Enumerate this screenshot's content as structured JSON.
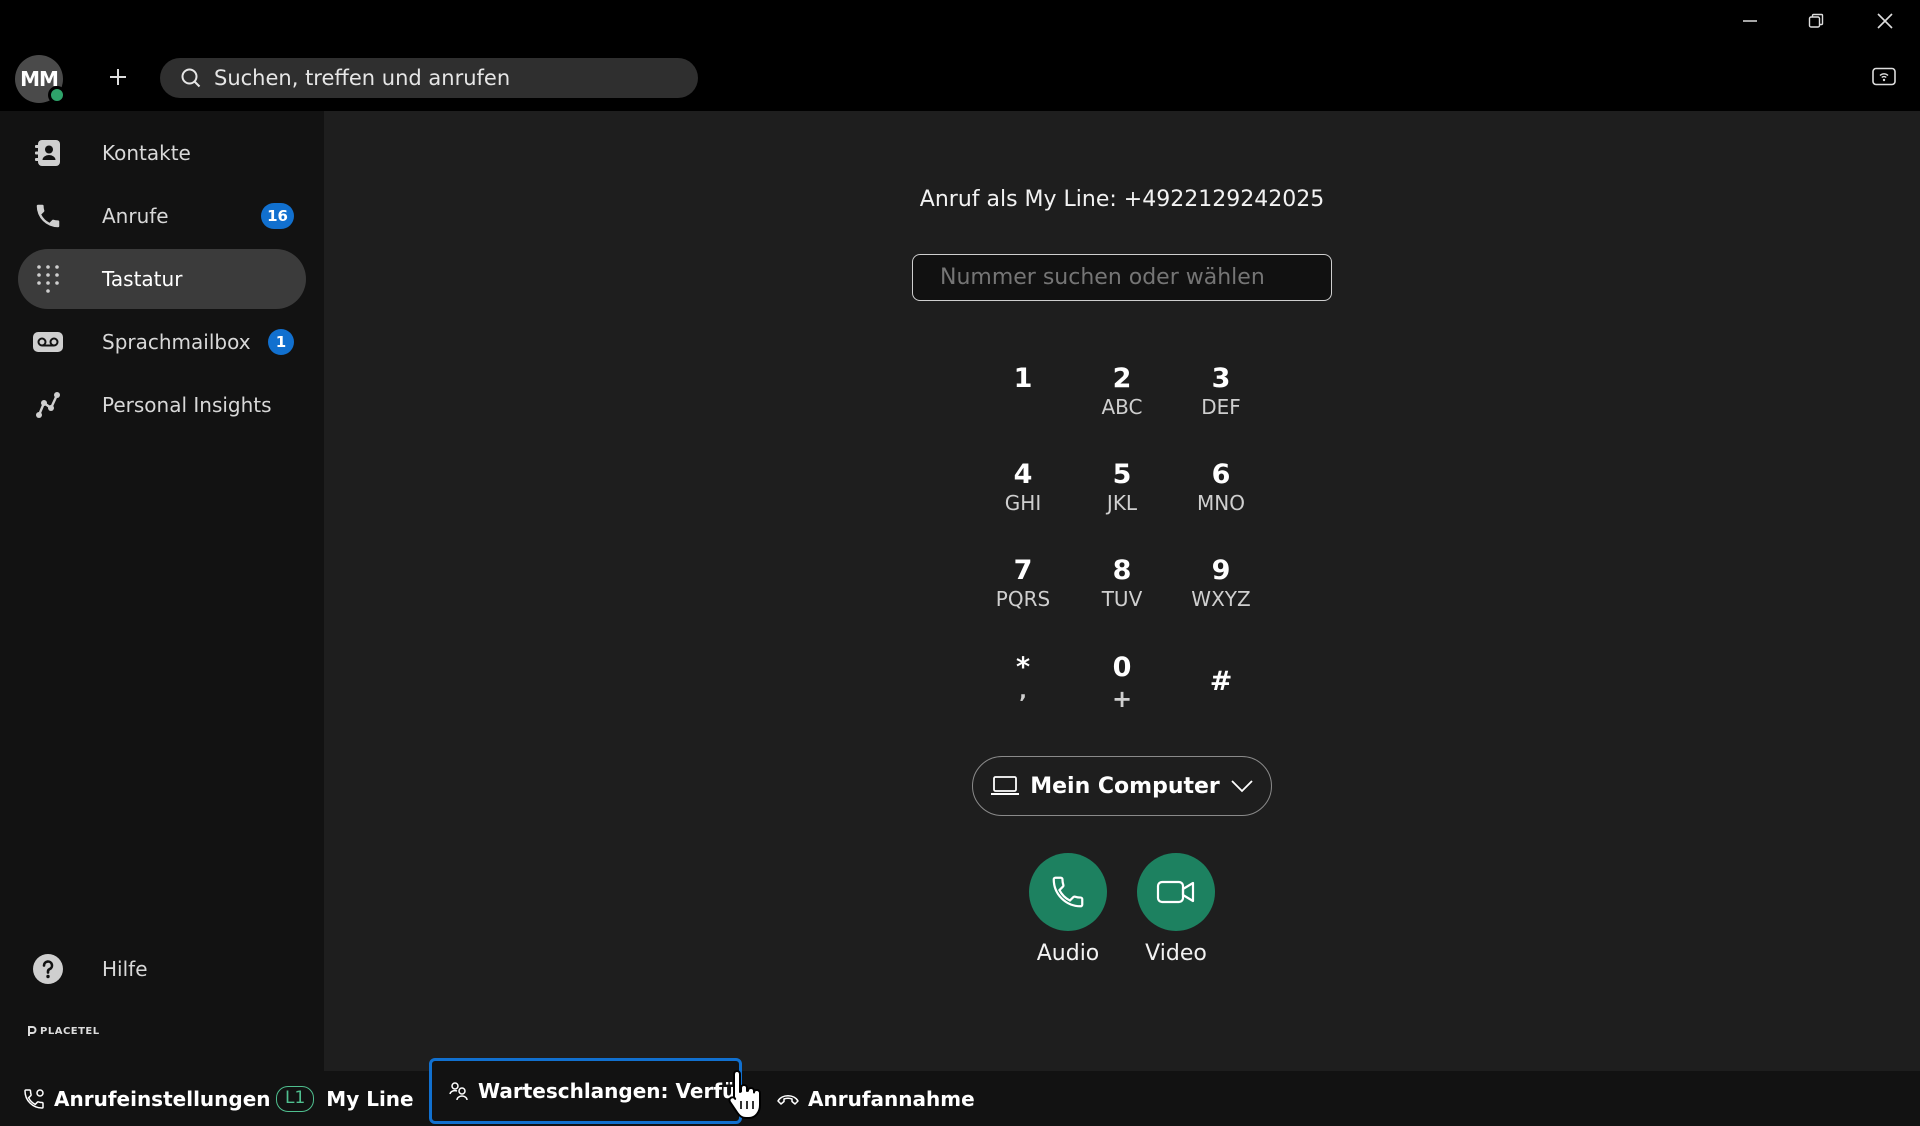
{
  "window": {
    "avatar_initials": "MM",
    "presence_color": "#2ea36a",
    "search_placeholder": "Suchen, treffen und anrufen"
  },
  "sidebar": {
    "items": [
      {
        "label": "Kontakte",
        "icon": "contacts-icon"
      },
      {
        "label": "Anrufe",
        "icon": "phone-icon",
        "badge": "16"
      },
      {
        "label": "Tastatur",
        "icon": "dialpad-icon",
        "active": true
      },
      {
        "label": "Sprachmailbox",
        "icon": "voicemail-icon",
        "badge": "1"
      },
      {
        "label": "Personal Insights",
        "icon": "insights-icon"
      }
    ],
    "help_label": "Hilfe",
    "brand": "PLACETEL"
  },
  "dialer": {
    "call_as": "Anruf als My Line: +4922129242025",
    "input_placeholder": "Nummer suchen oder wählen",
    "keys": [
      {
        "digit": "1",
        "letters": ""
      },
      {
        "digit": "2",
        "letters": "ABC"
      },
      {
        "digit": "3",
        "letters": "DEF"
      },
      {
        "digit": "4",
        "letters": "GHI"
      },
      {
        "digit": "5",
        "letters": "JKL"
      },
      {
        "digit": "6",
        "letters": "MNO"
      },
      {
        "digit": "7",
        "letters": "PQRS"
      },
      {
        "digit": "8",
        "letters": "TUV"
      },
      {
        "digit": "9",
        "letters": "WXYZ"
      },
      {
        "digit": "*",
        "letters": ","
      },
      {
        "digit": "0",
        "letters": "+"
      },
      {
        "digit": "#",
        "letters": ""
      }
    ],
    "device_label": "Mein Computer",
    "audio_label": "Audio",
    "video_label": "Video",
    "call_color": "#1d8160"
  },
  "statusbar": {
    "call_settings": "Anrufeinstellungen",
    "line_badge": "L1",
    "line_name": "My Line",
    "queues": "Warteschlangen: Verfügbar",
    "call_pickup": "Anrufannahme",
    "focus_color": "#1170cf"
  }
}
